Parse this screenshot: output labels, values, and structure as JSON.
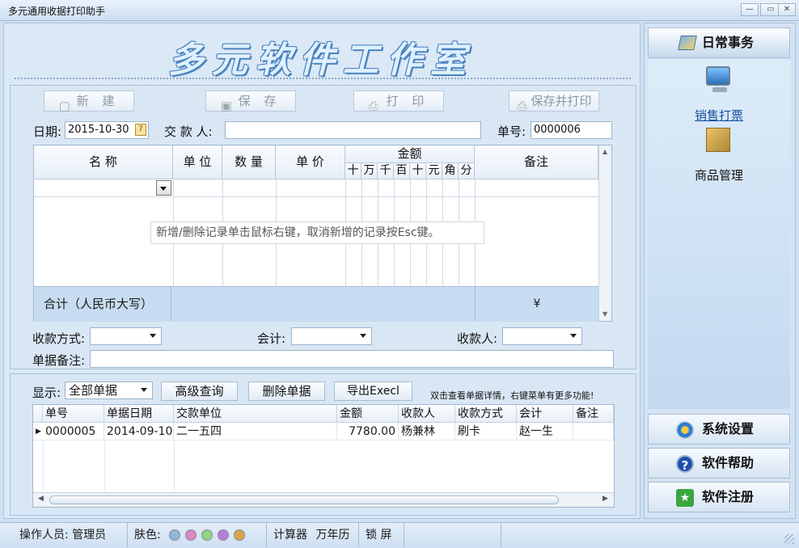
{
  "window": {
    "title": "多元通用收据打印助手"
  },
  "banner": {
    "text": "多元软件工作室"
  },
  "toolbar": {
    "new": "新 建",
    "save": "保 存",
    "print": "打 印",
    "save_print": "保存并打印"
  },
  "form": {
    "date_label": "日期:",
    "date_value": "2015-10-30",
    "payer_label": "交 款 人:",
    "payer_value": "",
    "number_label": "单号:",
    "number_value": "0000006",
    "tip": "新增/删除记录单击鼠标右键，取消新增的记录按Esc键。",
    "payment_method_label": "收款方式:",
    "accountant_label": "会计:",
    "receiver_label": "收款人:",
    "remark_label": "单据备注:"
  },
  "grid": {
    "col_name": "名    称",
    "col_unit": "单 位",
    "col_qty": "数 量",
    "col_price": "单  价",
    "col_amount": "金额",
    "amount_digits": [
      "十",
      "万",
      "千",
      "百",
      "十",
      "元",
      "角",
      "分"
    ],
    "col_remark": "备注",
    "total_label": "合计（人民币大写）",
    "total_symbol": "¥"
  },
  "list": {
    "show_label": "显示:",
    "show_value": "全部单据",
    "btn_query": "高级查询",
    "btn_delete": "删除单据",
    "btn_export": "导出Execl",
    "hint": "双击查看单据详情，右键菜单有更多功能!",
    "headers": [
      "单号",
      "单据日期",
      "交款单位",
      "金额",
      "收款人",
      "收款方式",
      "会计",
      "备注"
    ],
    "rows": [
      {
        "no": "0000005",
        "date": "2014-09-10",
        "unit": "二一五四",
        "amount": "7780.00",
        "receiver": "杨兼林",
        "method": "刷卡",
        "accountant": "赵一生",
        "remark": ""
      }
    ]
  },
  "sidebar": {
    "header": "日常事务",
    "items": [
      {
        "label": "销售打票"
      },
      {
        "label": "商品管理"
      }
    ],
    "settings": "系统设置",
    "help": "软件帮助",
    "register": "软件注册"
  },
  "status": {
    "operator": "操作人员: 管理员",
    "skin_label": "肤色:",
    "skin_colors": [
      "#8fb6d6",
      "#d889c0",
      "#8fd67f",
      "#b77fd6",
      "#d6a34a"
    ],
    "calculator": "计算器",
    "calendar": "万年历",
    "lock": "锁 屏"
  }
}
